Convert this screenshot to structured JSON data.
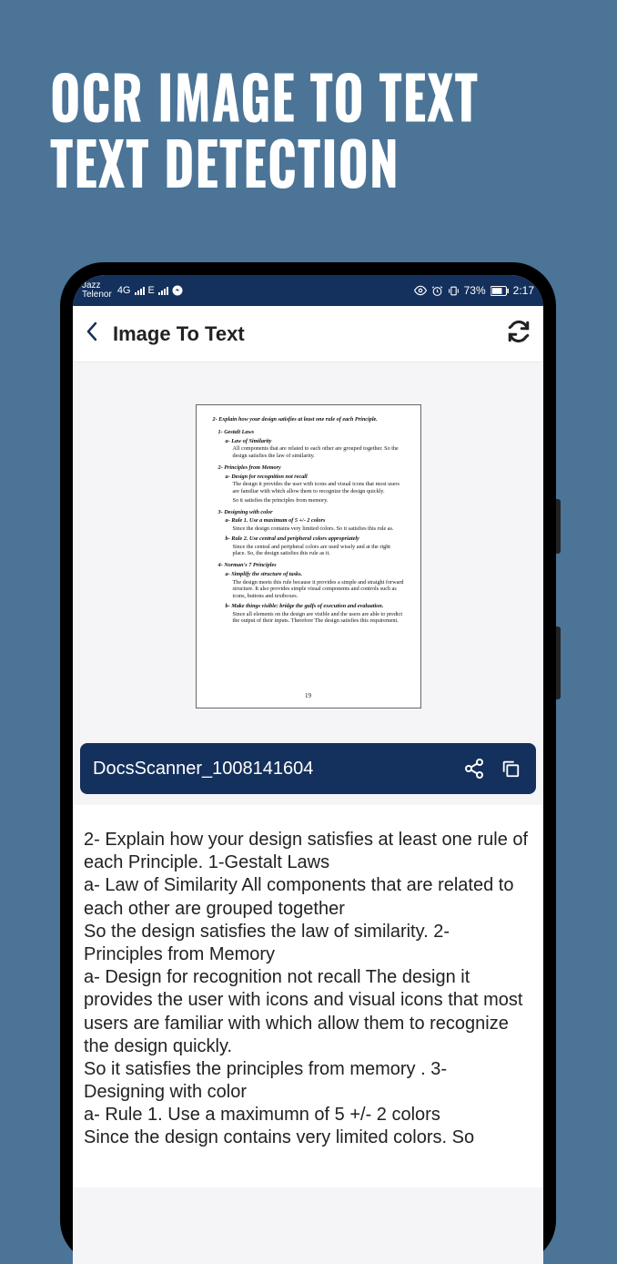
{
  "promo": {
    "line1": "OCR IMAGE TO TEXT",
    "line2": "TEXT DETECTION"
  },
  "status": {
    "carrier1": "Jazz",
    "carrier2": "Telenor",
    "net1": "4G",
    "net2": "E",
    "battery": "73%",
    "time": "2:17"
  },
  "header": {
    "title": "Image To Text"
  },
  "preview": {
    "main_title": "2- Explain how your design satisfies at least one rule of each Principle.",
    "s1": "1- Gestalt Laws",
    "s1a": "a- Law of Similarity",
    "s1a_p": "All components that are related to each other are grouped together. So the design satisfies the law of similarity.",
    "s2": "2- Principles from Memory",
    "s2a": "a- Design for recognition not recall",
    "s2a_p1": "The design it provides the user with icons and visual icons that most users are familiar with which allow them to recognize the design quickly.",
    "s2a_p2": "So it satisfies the principles from memory.",
    "s3": "3- Designing with color",
    "s3a": "a- Rule 1. Use a maximum of 5 +/- 2 colors",
    "s3a_p": "Since the design contains very limited colors. So it satisfies this rule as.",
    "s3b": "b- Rule 2. Use central and peripheral colors appropriately",
    "s3b_p": "Since the central and peripheral colors are used wisely and at the right place. So, the design satisfies this rule as it.",
    "s4": "4- Norman's 7 Principles",
    "s4a": "a- Simplify the structure of tasks.",
    "s4a_p": "The design meets this rule because it provides a simple and straight forward structure. It also provides simple visual components and controls such as icons, buttons and textboxes.",
    "s4b": "b- Make things visible: bridge the gulfs of execution and evaluation.",
    "s4b_p": "Since all elements on the design are visible and the users are able to predict the output of their inputs. Therefore The design satisfies this requirement.",
    "page_num": "19"
  },
  "result": {
    "filename": "DocsScanner_1008141604"
  },
  "ocr_text": "2- Explain how your design satisfies at least one rule of each Principle. 1-Gestalt Laws\na- Law of Similarity All components that are related to each other are grouped together\nSo the design satisfies the law of similarity. 2- Principles from Memory\na- Design for recognition not recall The design it provides the user with icons and visual icons that most\nusers are familiar with which allow them to recognize the design quickly.\nSo it satisfies the principles from memory . 3- Designing with color\na- Rule 1. Use a maximumn of 5 +/- 2 colors\nSince the design contains very limited colors. So"
}
